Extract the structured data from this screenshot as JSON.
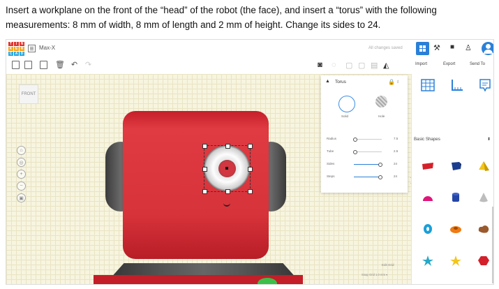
{
  "instruction": {
    "line1": "Insert a workplane on the front of the “head” of the robot (the face), and insert a “torus” with the following",
    "line2": "measurements: 8 mm of width, 8 mm of length and 2 mm of height. Change its sides to 24."
  },
  "app": {
    "logo_letters": [
      "T",
      "I",
      "N",
      "K",
      "E",
      "R",
      "C",
      "A",
      "D"
    ],
    "design_name": "Max-X",
    "save_status": "All changes saved",
    "panel_tabs": {
      "import": "Import",
      "export": "Export",
      "send_to": "Send To"
    },
    "viewcube_label": "FRONT"
  },
  "inspector": {
    "title": "Torus",
    "solid_label": "Solid",
    "hole_label": "Hole",
    "properties": [
      {
        "label": "Radius",
        "value": "7.5",
        "level": 0.05
      },
      {
        "label": "Tube",
        "value": "2.5",
        "level": 0.05
      },
      {
        "label": "Sides",
        "value": "24",
        "level": 0.95
      },
      {
        "label": "Steps",
        "value": "24",
        "level": 0.95
      }
    ]
  },
  "shapes_panel": {
    "category": "Basic Shapes",
    "items": [
      {
        "name": "text-shape",
        "color": "#d4202a"
      },
      {
        "name": "box-shape",
        "color": "#1a3d8f"
      },
      {
        "name": "pyramid-shape",
        "color": "#f3c51a"
      },
      {
        "name": "half-sphere-shape",
        "color": "#e0157a"
      },
      {
        "name": "cylinder-shape",
        "color": "#2546a8"
      },
      {
        "name": "cone-shape",
        "color": "#bdbdbd"
      },
      {
        "name": "torus-shape",
        "color": "#1a9fd8"
      },
      {
        "name": "tube-shape",
        "color": "#f07a12"
      },
      {
        "name": "scribble-shape",
        "color": "#9a5a2e"
      },
      {
        "name": "star-shape",
        "color": "#27a8c8"
      },
      {
        "name": "star-yellow-shape",
        "color": "#f3c51a"
      },
      {
        "name": "polygon-shape",
        "color": "#d4202a"
      },
      {
        "name": "ring-shape",
        "color": "#8a6a40"
      },
      {
        "name": "paraboloid-shape",
        "color": "#bdbdbd"
      },
      {
        "name": "ellipsoid-shape",
        "color": "#7ac0e0"
      }
    ]
  },
  "grid_controls": {
    "edit_grid": "Edit Grid",
    "snap_grid": "Snap Grid",
    "snap_value": "1.0 mm ▾"
  },
  "colors": {
    "accent": "#2a80d8",
    "robot_head": "#d7333b",
    "workplane": "#f7f4df"
  }
}
